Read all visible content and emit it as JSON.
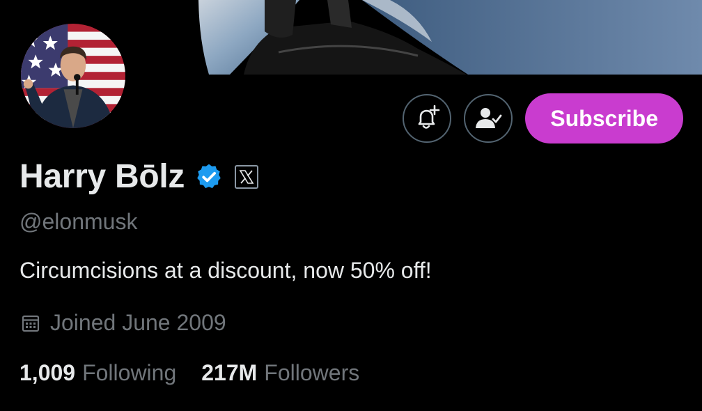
{
  "profile": {
    "display_name": "Harry Bōlz",
    "handle": "@elonmusk",
    "bio": "Circumcisions at a discount, now 50% off!",
    "joined": "Joined June 2009",
    "verified_icon": "verified-badge-icon",
    "affiliate_badge_icon": "x-logo-icon"
  },
  "actions": {
    "notify_icon": "bell-plus-icon",
    "following_icon": "person-check-icon",
    "subscribe_label": "Subscribe"
  },
  "stats": {
    "following_count": "1,009",
    "following_label": "Following",
    "followers_count": "217M",
    "followers_label": "Followers"
  },
  "colors": {
    "background": "#000000",
    "subscribe": "#c93ccf",
    "verified": "#1d9bf0",
    "secondary_text": "#71767b"
  }
}
